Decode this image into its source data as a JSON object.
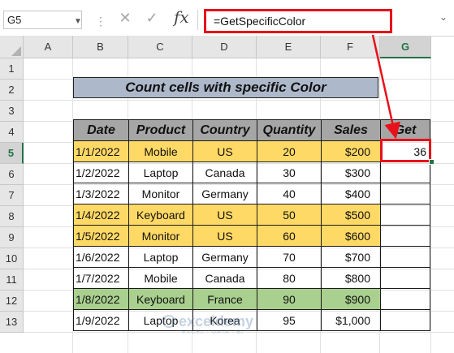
{
  "formula_bar": {
    "name_box": "G5",
    "cancel_glyph": "✕",
    "enter_glyph": "✓",
    "fx_label": "fx",
    "formula": "=GetSpecificColor"
  },
  "columns": [
    "A",
    "B",
    "C",
    "D",
    "E",
    "F",
    "G"
  ],
  "rows": [
    "1",
    "2",
    "3",
    "4",
    "5",
    "6",
    "7",
    "8",
    "9",
    "10",
    "11",
    "12",
    "13"
  ],
  "selected_column": "G",
  "selected_row": "5",
  "title": "Count cells with specific Color",
  "table": {
    "headers": [
      "Date",
      "Product",
      "Country",
      "Quantity",
      "Sales",
      "Get"
    ],
    "rows": [
      {
        "date": "1/1/2022",
        "product": "Mobile",
        "country": "US",
        "quantity": "20",
        "sales": "$200",
        "get": "36",
        "fill": "yellow"
      },
      {
        "date": "1/2/2022",
        "product": "Laptop",
        "country": "Canada",
        "quantity": "30",
        "sales": "$300",
        "get": "",
        "fill": "none"
      },
      {
        "date": "1/3/2022",
        "product": "Monitor",
        "country": "Germany",
        "quantity": "40",
        "sales": "$400",
        "get": "",
        "fill": "none"
      },
      {
        "date": "1/4/2022",
        "product": "Keyboard",
        "country": "US",
        "quantity": "50",
        "sales": "$500",
        "get": "",
        "fill": "yellow"
      },
      {
        "date": "1/5/2022",
        "product": "Monitor",
        "country": "US",
        "quantity": "60",
        "sales": "$600",
        "get": "",
        "fill": "yellow"
      },
      {
        "date": "1/6/2022",
        "product": "Laptop",
        "country": "Germany",
        "quantity": "70",
        "sales": "$700",
        "get": "",
        "fill": "none"
      },
      {
        "date": "1/7/2022",
        "product": "Mobile",
        "country": "Canada",
        "quantity": "80",
        "sales": "$800",
        "get": "",
        "fill": "none"
      },
      {
        "date": "1/8/2022",
        "product": "Keyboard",
        "country": "France",
        "quantity": "90",
        "sales": "$900",
        "get": "",
        "fill": "green"
      },
      {
        "date": "1/9/2022",
        "product": "Laptop",
        "country": "Korea",
        "quantity": "95",
        "sales": "$1,000",
        "get": "",
        "fill": "none"
      }
    ]
  },
  "colors": {
    "yellow_fill": "#ffd966",
    "green_fill": "#a9d08e",
    "title_fill": "#adb9ca",
    "header_fill": "#a6a6a6",
    "highlight_red": "#e8101a",
    "excel_green": "#217346"
  },
  "watermark": {
    "name": "exceldemy",
    "tagline": "EXCEL · DATA · BI"
  }
}
